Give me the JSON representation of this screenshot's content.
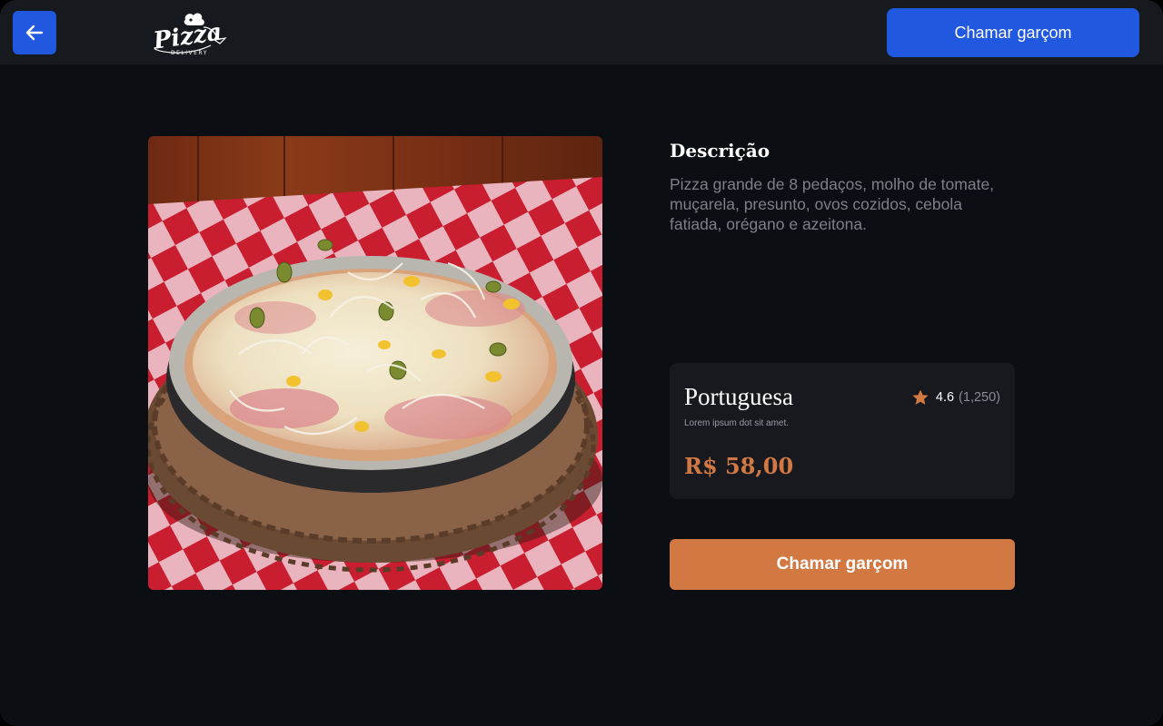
{
  "header": {
    "back_icon": "arrow-left-icon",
    "logo_text": "Pizza",
    "logo_subtext": "DELIVERY",
    "call_waiter_label": "Chamar garçom"
  },
  "product": {
    "image_alt": "Pizza Portuguesa",
    "description_title": "Descrição",
    "description_text": "Pizza grande de 8 pedaços, molho de tomate, muçarela, presunto, ovos cozidos, cebola fatiada, orégano e azeitona.",
    "name": "Portuguesa",
    "subtitle": "Lorem ipsum dot sit amet.",
    "rating_value": "4.6",
    "rating_count": "(1,250)",
    "rating_icon": "star-icon",
    "price": "R$ 58,00",
    "call_waiter_label": "Chamar garçom"
  },
  "colors": {
    "primary_blue": "#2158e0",
    "accent_orange": "#d27842",
    "background": "#0b0e13",
    "topbar": "#16191e",
    "card": "#17191e"
  }
}
